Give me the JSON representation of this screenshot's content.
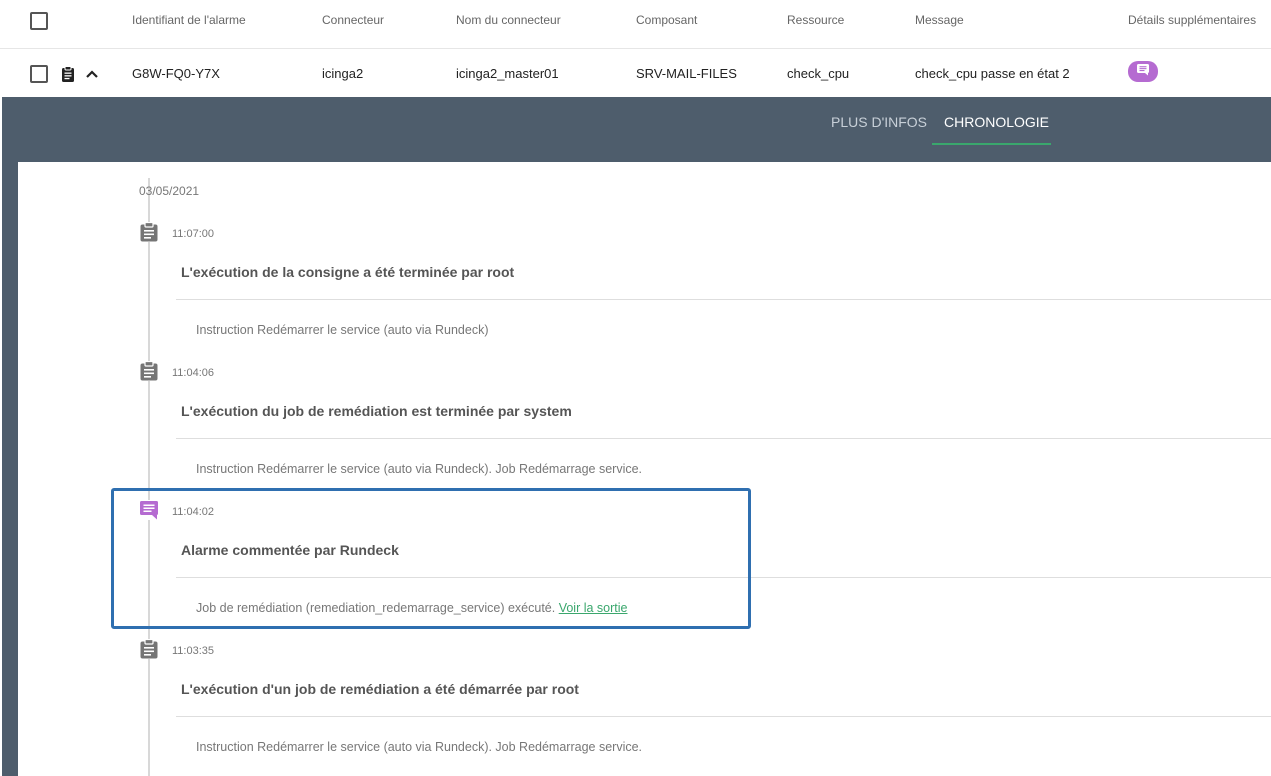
{
  "table": {
    "headers": {
      "alarm_id": "Identifiant de l'alarme",
      "connector": "Connecteur",
      "connector_name": "Nom du connecteur",
      "component": "Composant",
      "resource": "Ressource",
      "message": "Message",
      "extra_details": "Détails supplémentaires"
    },
    "row": {
      "alarm_id": "G8W-FQ0-Y7X",
      "connector": "icinga2",
      "connector_name": "icinga2_master01",
      "component": "SRV-MAIL-FILES",
      "resource": "check_cpu",
      "message": "check_cpu passe en état 2"
    }
  },
  "tabs": {
    "more_info": "PLUS D'INFOS",
    "timeline": "CHRONOLOGIE",
    "active": "timeline"
  },
  "timeline": {
    "date": "03/05/2021",
    "events": [
      {
        "icon": "clipboard-icon",
        "time": "11:07:00",
        "title": "L'exécution de la consigne a été terminée par root",
        "description": "Instruction Redémarrer le service (auto via Rundeck)"
      },
      {
        "icon": "clipboard-icon",
        "time": "11:04:06",
        "title": "L'exécution du job de remédiation est terminée par system",
        "description": "Instruction Redémarrer le service (auto via Rundeck). Job Redémarrage service."
      },
      {
        "icon": "comment-icon",
        "time": "11:04:02",
        "title": "Alarme commentée par Rundeck",
        "description": "Job de remédiation (remediation_redemarrage_service) exécuté.",
        "link": "Voir la sortie"
      },
      {
        "icon": "clipboard-icon",
        "time": "11:03:35",
        "title": "L'exécution d'un job de remédiation a été démarrée par root",
        "description": "Instruction Redémarrer le service (auto via Rundeck). Job Redémarrage service."
      }
    ]
  },
  "colors": {
    "panel_bg": "#4e5d6c",
    "accent_green": "#3aa76d",
    "comment_purple": "#b56bd1",
    "highlight_blue": "#2f6fb0"
  }
}
